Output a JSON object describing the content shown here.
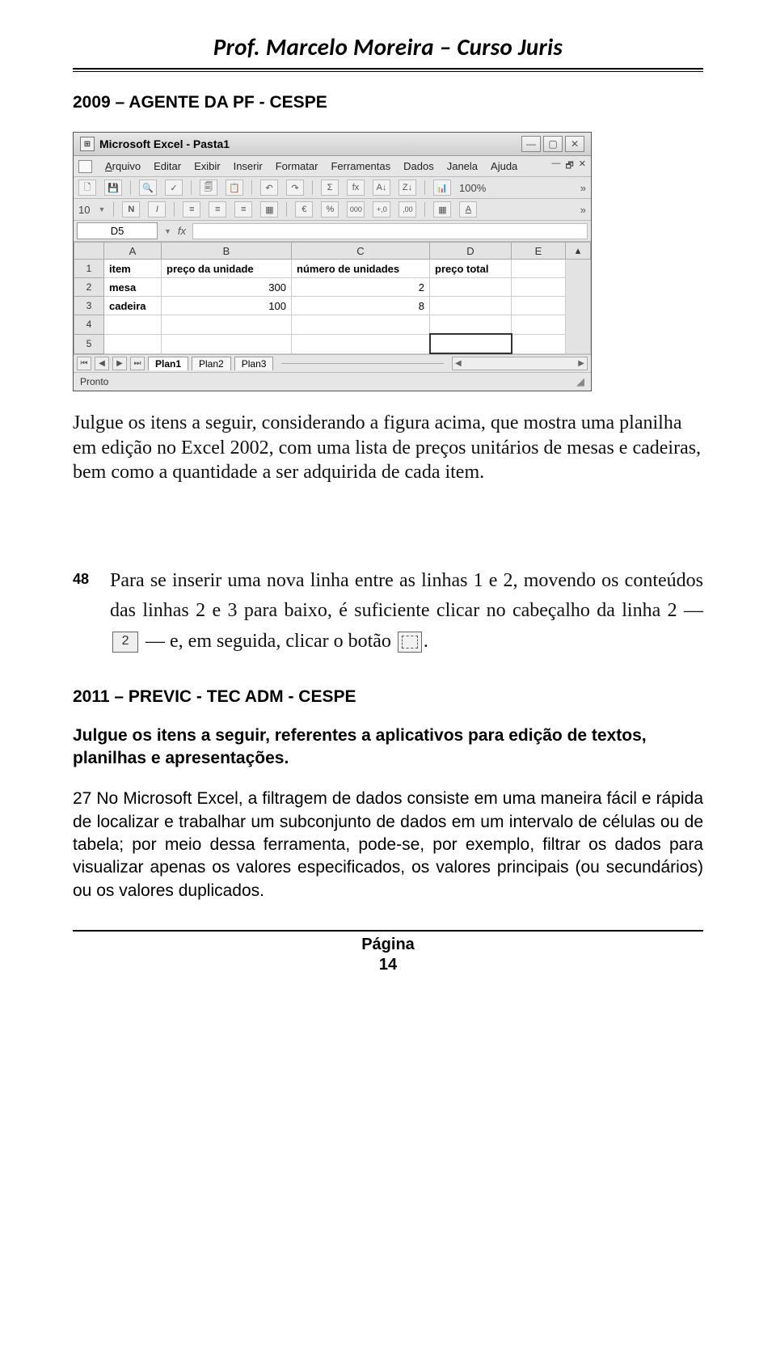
{
  "header": {
    "title": "Prof. Marcelo Moreira – Curso Juris"
  },
  "section1_title": "2009 – AGENTE DA PF - CESPE",
  "excel": {
    "title": "Microsoft Excel - Pasta1",
    "menu": {
      "arquivo": "Arquivo",
      "editar": "Editar",
      "exibir": "Exibir",
      "inserir": "Inserir",
      "formatar": "Formatar",
      "ferramentas": "Ferramentas",
      "dados": "Dados",
      "janela": "Janela",
      "ajuda": "Ajuda"
    },
    "font_size": "10",
    "zoom": "100%",
    "namebox": "D5",
    "fx": "fx",
    "cols": {
      "A": "A",
      "B": "B",
      "C": "C",
      "D": "D",
      "E": "E"
    },
    "rows": [
      "1",
      "2",
      "3",
      "4",
      "5"
    ],
    "headers": {
      "item": "item",
      "preco_unidade": "preço da unidade",
      "num_unidades": "número de unidades",
      "preco_total": "preço total"
    },
    "r2": {
      "item": "mesa",
      "preco": "300",
      "qtd": "2"
    },
    "r3": {
      "item": "cadeira",
      "preco": "100",
      "qtd": "8"
    },
    "sheets": {
      "p1": "Plan1",
      "p2": "Plan2",
      "p3": "Plan3"
    },
    "status": "Pronto"
  },
  "intro_text": "Julgue os itens a seguir, considerando a figura acima, que mostra uma planilha em edição no Excel 2002, com uma lista de preços unitários de mesas e cadeiras, bem como a quantidade a ser adquirida de cada item.",
  "q48": {
    "num": "48",
    "p1": "Para se inserir uma nova linha entre as linhas 1 e 2, movendo os conteúdos das linhas 2 e 3 para baixo, é suficiente clicar no cabeçalho da linha 2 — ",
    "row_label": "2",
    "p2": " — e, em seguida, clicar o botão ",
    "p3": "."
  },
  "section2_title": "2011 – PREVIC - TEC ADM - CESPE",
  "q_stem": "Julgue os itens a seguir, referentes a aplicativos para edição de textos, planilhas e apresentações.",
  "q27_text": "27 No Microsoft Excel, a filtragem de dados consiste em uma maneira fácil e rápida de localizar e trabalhar um subconjunto de dados em um intervalo de células ou de tabela; por meio dessa ferramenta, pode-se, por exemplo, filtrar os dados para visualizar apenas os valores especificados, os valores principais (ou secundários) ou os valores duplicados.",
  "footer": {
    "label": "Página",
    "num": "14"
  }
}
